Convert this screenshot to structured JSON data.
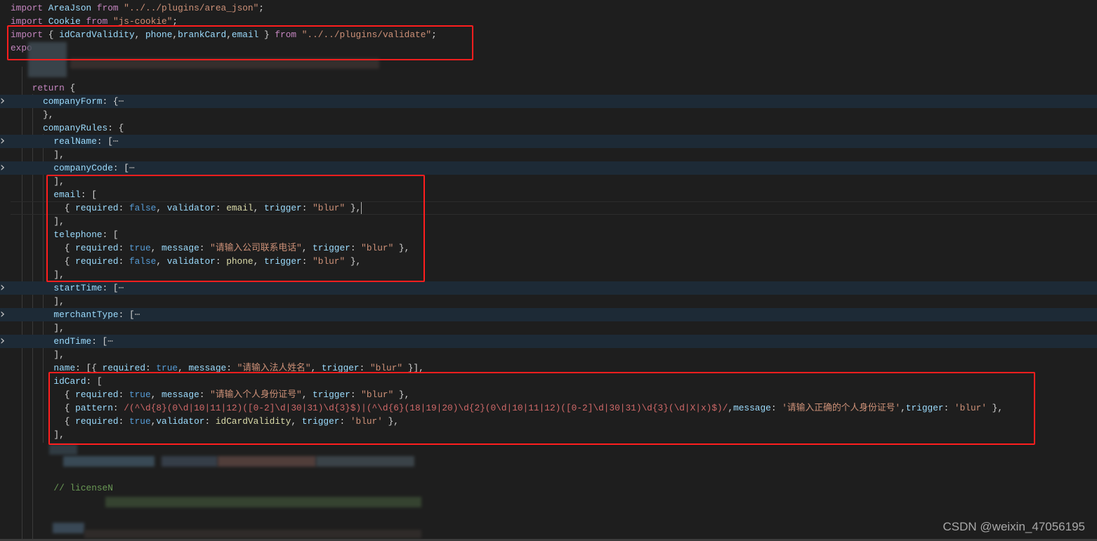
{
  "code": {
    "lines": [
      {
        "n": 0,
        "tokens": [
          [
            "import ",
            "kw"
          ],
          [
            "AreaJson ",
            "var"
          ],
          [
            "from ",
            "kw"
          ],
          [
            "\"../../plugins/area_json\"",
            "str"
          ],
          [
            ";",
            "plain"
          ]
        ]
      },
      {
        "n": 1,
        "tokens": [
          [
            "import ",
            "kw"
          ],
          [
            "Cookie ",
            "var"
          ],
          [
            "from ",
            "kw"
          ],
          [
            "\"js-cookie\"",
            "str"
          ],
          [
            ";",
            "plain"
          ]
        ]
      },
      {
        "n": 2,
        "tokens": [
          [
            "import ",
            "kw"
          ],
          [
            "{ ",
            "plain"
          ],
          [
            "idCardValidity",
            "var"
          ],
          [
            ", ",
            "plain"
          ],
          [
            "phone",
            "var"
          ],
          [
            ",",
            "plain"
          ],
          [
            "brankCard",
            "var"
          ],
          [
            ",",
            "plain"
          ],
          [
            "email ",
            "var"
          ],
          [
            "} ",
            "plain"
          ],
          [
            "from ",
            "kw"
          ],
          [
            "\"../../plugins/validate\"",
            "str"
          ],
          [
            ";",
            "plain"
          ]
        ]
      },
      {
        "n": 3,
        "tokens": [
          [
            "expo",
            "kw"
          ]
        ]
      },
      {
        "n": 6,
        "tokens": [
          [
            "    return ",
            "kw"
          ],
          [
            "{",
            "plain"
          ]
        ]
      },
      {
        "n": 7,
        "folded": true,
        "tokens": [
          [
            "      companyForm",
            "var"
          ],
          [
            ": {",
            "plain"
          ],
          [
            "⋯",
            "ell"
          ]
        ]
      },
      {
        "n": 8,
        "tokens": [
          [
            "      },",
            "plain"
          ]
        ]
      },
      {
        "n": 9,
        "tokens": [
          [
            "      companyRules",
            "var"
          ],
          [
            ": {",
            "plain"
          ]
        ]
      },
      {
        "n": 10,
        "folded": true,
        "tokens": [
          [
            "        realName",
            "var"
          ],
          [
            ": [",
            "plain"
          ],
          [
            "⋯",
            "ell"
          ]
        ]
      },
      {
        "n": 11,
        "tokens": [
          [
            "        ],",
            "plain"
          ]
        ]
      },
      {
        "n": 12,
        "folded": true,
        "tokens": [
          [
            "        companyCode",
            "var"
          ],
          [
            ": [",
            "plain"
          ],
          [
            "⋯",
            "ell"
          ]
        ]
      },
      {
        "n": 13,
        "tokens": [
          [
            "        ],",
            "plain"
          ]
        ]
      },
      {
        "n": 14,
        "tokens": [
          [
            "        email",
            "var"
          ],
          [
            ": [",
            "plain"
          ]
        ]
      },
      {
        "n": 15,
        "tokens": [
          [
            "          { ",
            "plain"
          ],
          [
            "required",
            "var"
          ],
          [
            ": ",
            "plain"
          ],
          [
            "false",
            "bool"
          ],
          [
            ", ",
            "plain"
          ],
          [
            "validator",
            "var"
          ],
          [
            ": ",
            "plain"
          ],
          [
            "email",
            "fn"
          ],
          [
            ", ",
            "plain"
          ],
          [
            "trigger",
            "var"
          ],
          [
            ": ",
            "plain"
          ],
          [
            "\"blur\"",
            "str"
          ],
          [
            " },",
            "plain"
          ]
        ]
      },
      {
        "n": 16,
        "tokens": [
          [
            "        ],",
            "plain"
          ]
        ]
      },
      {
        "n": 17,
        "tokens": [
          [
            "        telephone",
            "var"
          ],
          [
            ": [",
            "plain"
          ]
        ]
      },
      {
        "n": 18,
        "tokens": [
          [
            "          { ",
            "plain"
          ],
          [
            "required",
            "var"
          ],
          [
            ": ",
            "plain"
          ],
          [
            "true",
            "bool"
          ],
          [
            ", ",
            "plain"
          ],
          [
            "message",
            "var"
          ],
          [
            ": ",
            "plain"
          ],
          [
            "\"请输入公司联系电话\"",
            "str"
          ],
          [
            ", ",
            "plain"
          ],
          [
            "trigger",
            "var"
          ],
          [
            ": ",
            "plain"
          ],
          [
            "\"blur\"",
            "str"
          ],
          [
            " },",
            "plain"
          ]
        ]
      },
      {
        "n": 19,
        "tokens": [
          [
            "          { ",
            "plain"
          ],
          [
            "required",
            "var"
          ],
          [
            ": ",
            "plain"
          ],
          [
            "false",
            "bool"
          ],
          [
            ", ",
            "plain"
          ],
          [
            "validator",
            "var"
          ],
          [
            ": ",
            "plain"
          ],
          [
            "phone",
            "fn"
          ],
          [
            ", ",
            "plain"
          ],
          [
            "trigger",
            "var"
          ],
          [
            ": ",
            "plain"
          ],
          [
            "\"blur\"",
            "str"
          ],
          [
            " },",
            "plain"
          ]
        ]
      },
      {
        "n": 20,
        "tokens": [
          [
            "        ],",
            "plain"
          ]
        ]
      },
      {
        "n": 21,
        "folded": true,
        "tokens": [
          [
            "        startTime",
            "var"
          ],
          [
            ": [",
            "plain"
          ],
          [
            "⋯",
            "ell"
          ]
        ]
      },
      {
        "n": 22,
        "tokens": [
          [
            "        ],",
            "plain"
          ]
        ]
      },
      {
        "n": 23,
        "folded": true,
        "tokens": [
          [
            "        merchantType",
            "var"
          ],
          [
            ": [",
            "plain"
          ],
          [
            "⋯",
            "ell"
          ]
        ]
      },
      {
        "n": 24,
        "tokens": [
          [
            "        ],",
            "plain"
          ]
        ]
      },
      {
        "n": 25,
        "folded": true,
        "tokens": [
          [
            "        endTime",
            "var"
          ],
          [
            ": [",
            "plain"
          ],
          [
            "⋯",
            "ell"
          ]
        ]
      },
      {
        "n": 26,
        "tokens": [
          [
            "        ],",
            "plain"
          ]
        ]
      },
      {
        "n": 27,
        "tokens": [
          [
            "        name",
            "var"
          ],
          [
            ": [{ ",
            "plain"
          ],
          [
            "required",
            "var"
          ],
          [
            ": ",
            "plain"
          ],
          [
            "true",
            "bool"
          ],
          [
            ", ",
            "plain"
          ],
          [
            "message",
            "var"
          ],
          [
            ": ",
            "plain"
          ],
          [
            "\"请输入法人姓名\"",
            "str"
          ],
          [
            ", ",
            "plain"
          ],
          [
            "trigger",
            "var"
          ],
          [
            ": ",
            "plain"
          ],
          [
            "\"blur\"",
            "str"
          ],
          [
            " }],",
            "plain"
          ]
        ]
      },
      {
        "n": 28,
        "tokens": [
          [
            "        idCard",
            "var"
          ],
          [
            ": [",
            "plain"
          ]
        ]
      },
      {
        "n": 29,
        "tokens": [
          [
            "          { ",
            "plain"
          ],
          [
            "required",
            "var"
          ],
          [
            ": ",
            "plain"
          ],
          [
            "true",
            "bool"
          ],
          [
            ", ",
            "plain"
          ],
          [
            "message",
            "var"
          ],
          [
            ": ",
            "plain"
          ],
          [
            "\"请输入个人身份证号\"",
            "str"
          ],
          [
            ", ",
            "plain"
          ],
          [
            "trigger",
            "var"
          ],
          [
            ": ",
            "plain"
          ],
          [
            "\"blur\"",
            "str"
          ],
          [
            " },",
            "plain"
          ]
        ]
      },
      {
        "n": 30,
        "tokens": [
          [
            "          { ",
            "plain"
          ],
          [
            "pattern",
            "var"
          ],
          [
            ": ",
            "plain"
          ],
          [
            "/(^\\d{8}(0\\d|10|11|12)([0-2]\\d|30|31)\\d{3}$)|(^\\d{6}(18|19|20)\\d{2}(0\\d|10|11|12)([0-2]\\d|30|31)\\d{3}(\\d|X|x)$)/",
            "re"
          ],
          [
            ",",
            "plain"
          ],
          [
            "message",
            "var"
          ],
          [
            ": ",
            "plain"
          ],
          [
            "'请输入正确的个人身份证号'",
            "str"
          ],
          [
            ",",
            "plain"
          ],
          [
            "trigger",
            "var"
          ],
          [
            ": ",
            "plain"
          ],
          [
            "'blur'",
            "str"
          ],
          [
            " },",
            "plain"
          ]
        ]
      },
      {
        "n": 31,
        "tokens": [
          [
            "          { ",
            "plain"
          ],
          [
            "required",
            "var"
          ],
          [
            ": ",
            "plain"
          ],
          [
            "true",
            "bool"
          ],
          [
            ",",
            "plain"
          ],
          [
            "validator",
            "var"
          ],
          [
            ": ",
            "plain"
          ],
          [
            "idCardValidity",
            "fn"
          ],
          [
            ", ",
            "plain"
          ],
          [
            "trigger",
            "var"
          ],
          [
            ": ",
            "plain"
          ],
          [
            "'blur'",
            "str"
          ],
          [
            " },",
            "plain"
          ]
        ]
      },
      {
        "n": 32,
        "tokens": [
          [
            "        ],",
            "plain"
          ]
        ]
      },
      {
        "n": 36,
        "tokens": [
          [
            "        // licenseN",
            "cmt"
          ]
        ]
      }
    ]
  },
  "watermark": "CSDN @weixin_47056195",
  "colors": {
    "annotation_box": "#ff1e1e",
    "background": "#1e1e1e"
  }
}
